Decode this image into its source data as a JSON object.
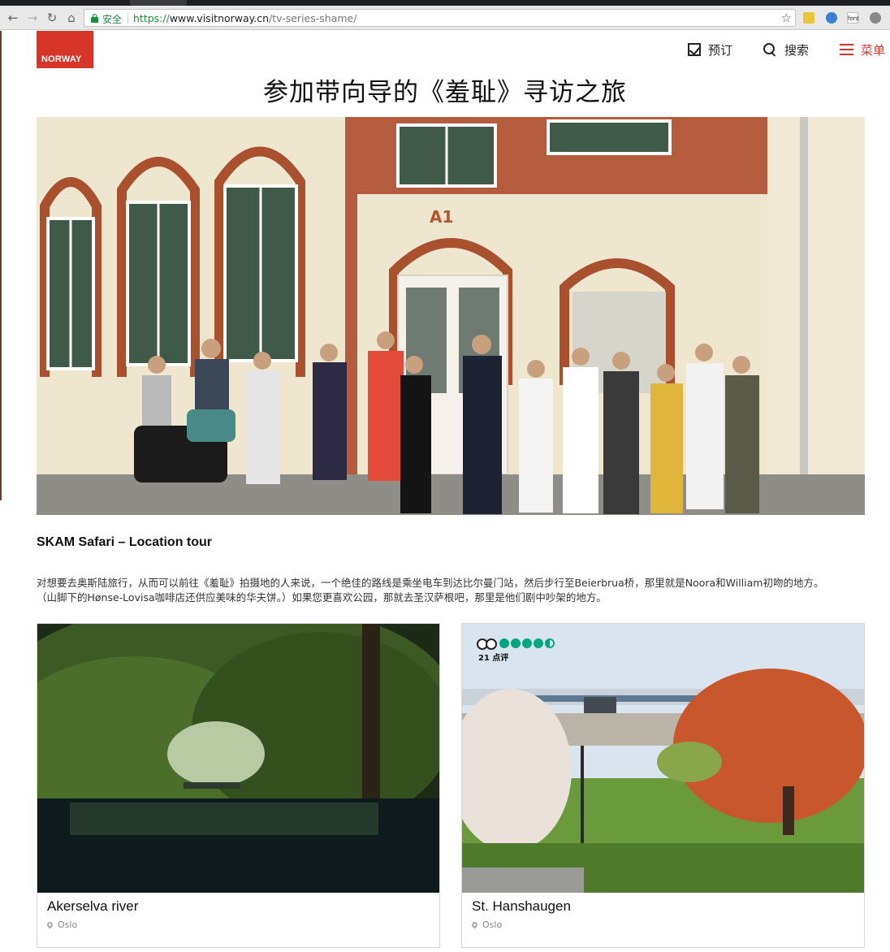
{
  "browser": {
    "url_scheme": "https://",
    "url_host": "www.visitnorway.cn",
    "url_path": "/tv-series-shame/",
    "secure_label": "安全",
    "ext_label": "font"
  },
  "header": {
    "logo_text": "NORWAY",
    "book_label": "预订",
    "search_label": "搜索",
    "menu_label": "菜单",
    "brand_color": "#d7342a"
  },
  "page": {
    "title": "参加带向导的《羞耻》寻访之旅",
    "hero_sign": "A1",
    "sub_heading": "SKAM Safari – Location tour",
    "body_line1": "对想要去奥斯陆旅行，从而可以前往《羞耻》拍摄地的人来说，一个绝佳的路线是乘坐电车到达比尔曼门站，然后步行至Beierbrua桥，那里就是Noora和William初吻的地方。",
    "body_line2": "（山脚下的Hønse-Lovisa咖啡店还供应美味的华夫饼。）如果您更喜欢公园，那就去圣汉萨根吧，那里是他们剧中吵架的地方。"
  },
  "cards": [
    {
      "title": "Akerselva river",
      "location": "Oslo"
    },
    {
      "title": "St. Hanshaugen",
      "location": "Oslo",
      "rating_count": "21 点评",
      "rating_value": 4.5
    }
  ]
}
